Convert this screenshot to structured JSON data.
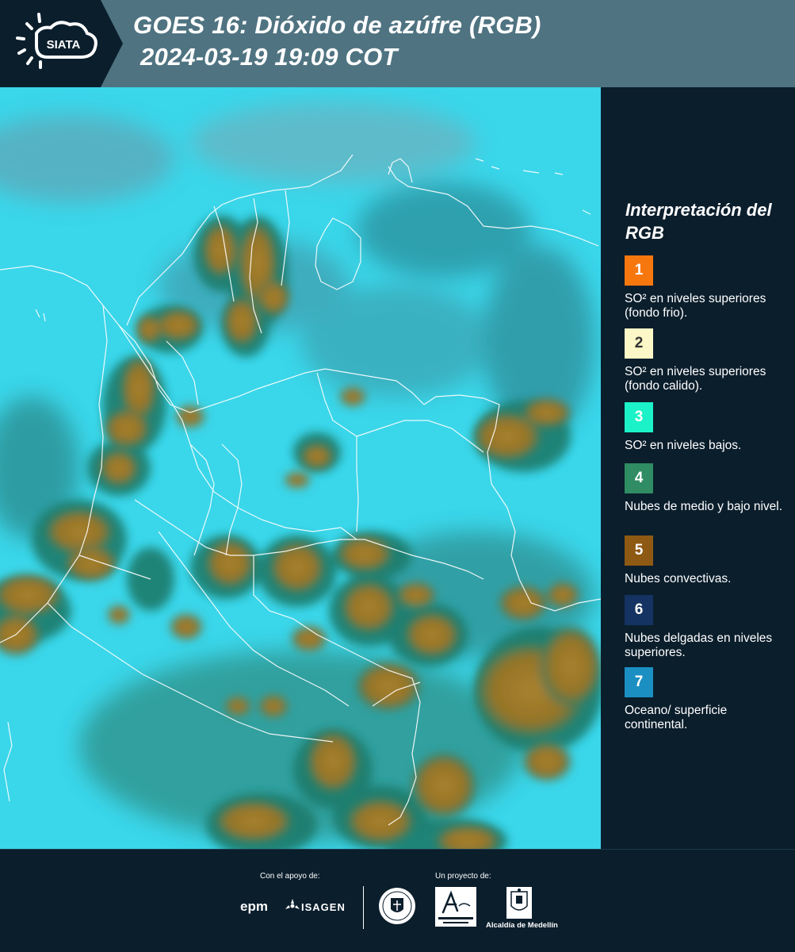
{
  "header": {
    "logo_text": "SIATA",
    "title_line1": "GOES 16: Dióxido de azúfre (RGB)",
    "title_line2": "2024-03-19 19:09 COT"
  },
  "legend": {
    "title": "Interpretación del RGB",
    "items": [
      {
        "number": "1",
        "label": "SO² en niveles superiores (fondo frio).",
        "color": "#f7770f",
        "text_color": "#ffffff"
      },
      {
        "number": "2",
        "label": "SO² en niveles superiores (fondo calido).",
        "color": "#fbf7c6",
        "text_color": "#333333"
      },
      {
        "number": "3",
        "label": "SO² en niveles bajos.",
        "color": "#1cf2c8",
        "text_color": "#ffffff"
      },
      {
        "number": "4",
        "label": "Nubes de medio y bajo nivel.",
        "color": "#2f8c63",
        "text_color": "#ffffff"
      },
      {
        "number": "5",
        "label": "Nubes convectivas.",
        "color": "#8e5a13",
        "text_color": "#ffffff"
      },
      {
        "number": "6",
        "label": "Nubes delgadas en niveles superiores.",
        "color": "#143362",
        "text_color": "#ffffff"
      },
      {
        "number": "7",
        "label": "Oceano/ superficie continental.",
        "color": "#1b8fc2",
        "text_color": "#ffffff"
      }
    ]
  },
  "map": {
    "background_color": "#3ad6ea",
    "cloud_color": "#9e7a2e",
    "cloud_edge_color": "#1f7b6c",
    "border_color": "#ffffff"
  },
  "footer": {
    "support_label": "Con el apoyo de:",
    "project_label": "Un proyecto de:",
    "sponsors": [
      "epm",
      "ISAGEN"
    ],
    "partners": [
      "Área Metropolitana Valle de Aburrá",
      "Alcaldía de Medellín"
    ],
    "alcaldia_label": "Alcaldía de Medellín"
  }
}
